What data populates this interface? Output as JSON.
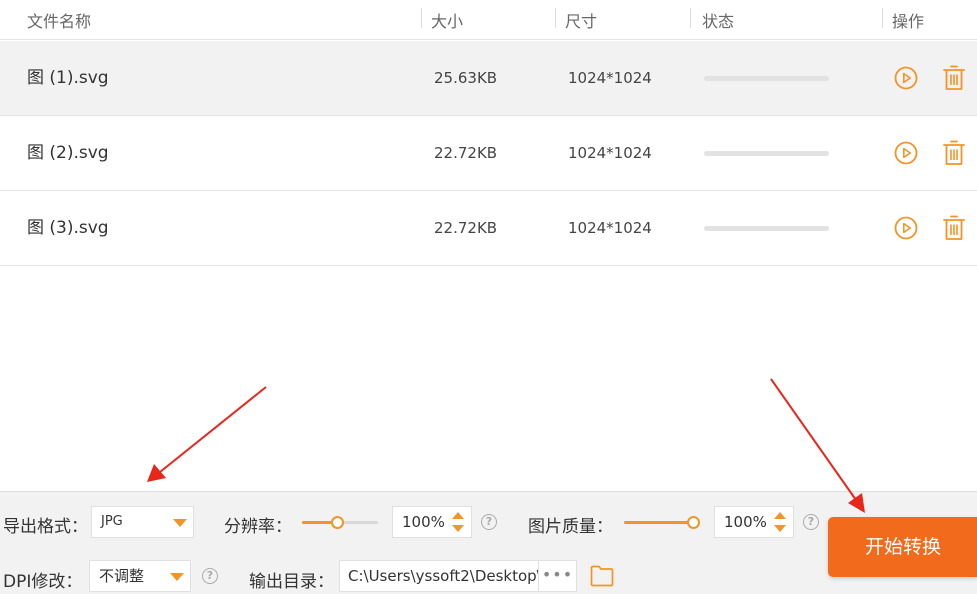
{
  "columns": {
    "name": "文件名称",
    "size": "大小",
    "dimensions": "尺寸",
    "status": "状态",
    "actions": "操作"
  },
  "files": [
    {
      "name": "图 (1).svg",
      "size": "25.63KB",
      "dimensions": "1024*1024",
      "progress": 0,
      "selected": true
    },
    {
      "name": "图 (2).svg",
      "size": "22.72KB",
      "dimensions": "1024*1024",
      "progress": 0,
      "selected": false
    },
    {
      "name": "图 (3).svg",
      "size": "22.72KB",
      "dimensions": "1024*1024",
      "progress": 0,
      "selected": false
    }
  ],
  "settings": {
    "format_label": "导出格式：",
    "format_value": "JPG",
    "resolution_label": "分辨率：",
    "resolution_value": "100",
    "resolution_unit": "%",
    "resolution_slider_fraction": 0.46,
    "quality_label": "图片质量：",
    "quality_value": "100",
    "quality_unit": "%",
    "quality_slider_fraction": 1.0,
    "dpi_label": "DPI修改：",
    "dpi_value": "不调整",
    "output_label": "输出目录：",
    "output_path": "C:\\Users\\yssoft2\\Desktop\\",
    "browse_label": "•••",
    "help_symbol": "?"
  },
  "start_button": "开始转换",
  "colors": {
    "accent": "#f39426",
    "button": "#f26a1b",
    "annotation_arrow": "#e8261c"
  },
  "icons": {
    "play": "play-circle-icon",
    "delete": "trash-icon",
    "folder": "folder-icon",
    "help": "question-circle-icon",
    "dropdown": "caret-down-icon"
  }
}
